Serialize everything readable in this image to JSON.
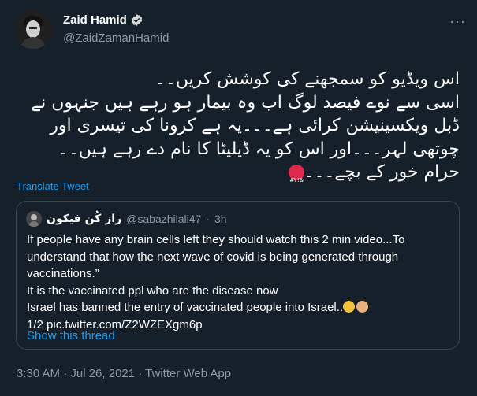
{
  "author": {
    "name": "Zaid Hamid",
    "handle": "@ZaidZamanHamid"
  },
  "tweet": {
    "lines": [
      "اس ویڈیو کو سمجھنے کی کوشش کریں۔۔",
      "اسی سے نوے فیصد لوگ اب وہ بیمار ہو رہے ہیں جنہوں نے",
      "ڈبل ویکسینیشن کرائی ہے۔۔۔یہ ہے کرونا کی تیسری اور",
      "چوتھی لہر۔۔۔اور اس کو یہ ڈیلیٹا کا نام دے رہے ہیں۔۔",
      "حرام خور کے بچے۔۔۔"
    ],
    "translate_label": "Translate Tweet"
  },
  "quoted": {
    "name": "راز کُن فیکون",
    "handle": "@sabazhilali47",
    "separator": "·",
    "time": "3h",
    "lines": [
      "If people have any brain cells left they should watch this 2 min video...To",
      "understand that how the next wave of covid is being generated through",
      "vaccinations.”",
      "It is the vaccinated ppl who are the disease now",
      "Israel has banned the entry of vaccinated people into Israel..",
      "1/2 pic.twitter.com/Z2WZEXgm6p"
    ],
    "show_thread": "Show this thread"
  },
  "footer": {
    "meta": "3:30 AM · Jul 26, 2021 · Twitter Web App"
  },
  "colors": {
    "background": "#15202b",
    "link": "#1d9bf0",
    "verified": "#1d9bf0",
    "muted": "#8b98a5",
    "border": "#38444d"
  },
  "icons": [
    "verified-badge-icon",
    "more-options-icon",
    "angry-face-emoji",
    "flushed-face-emoji",
    "man-facepalming-emoji"
  ]
}
